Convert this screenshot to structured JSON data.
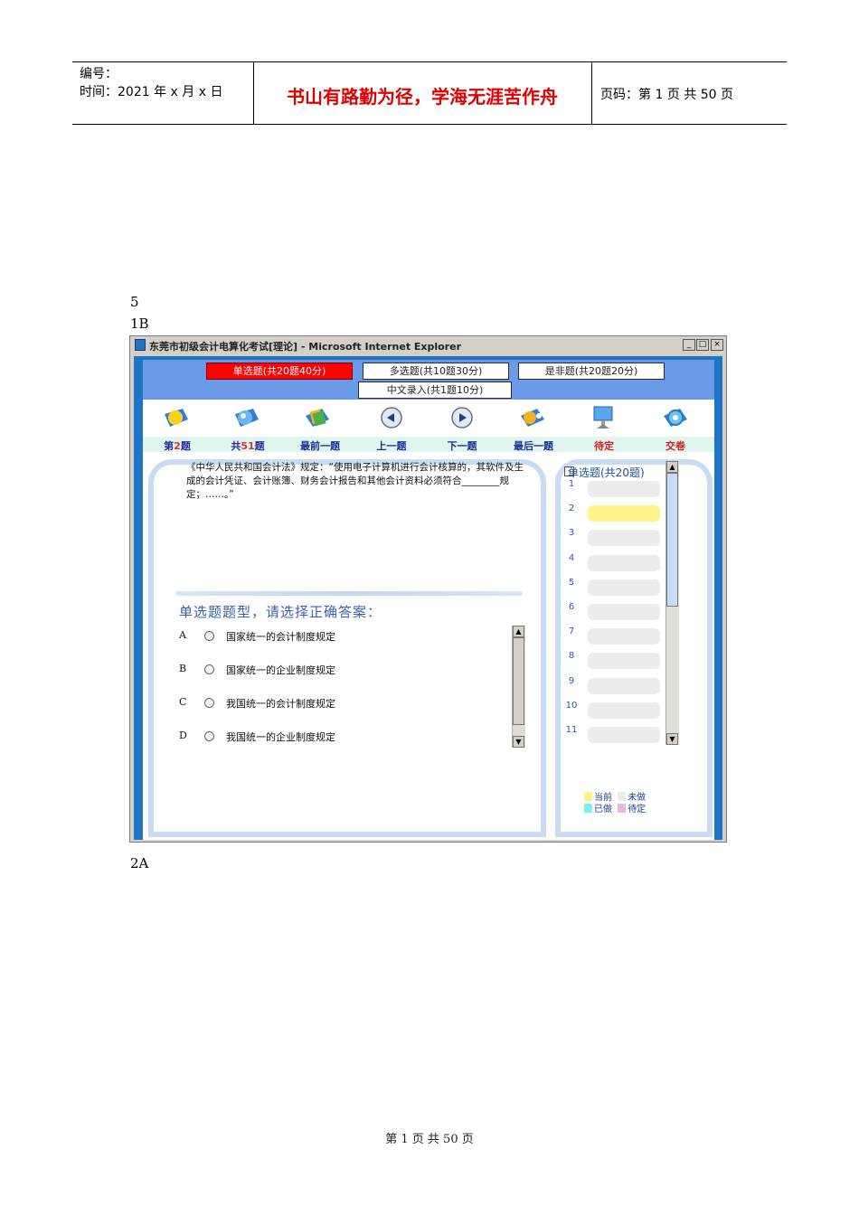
{
  "header": {
    "number_label": "编号：",
    "time_label": "时间：2021 年 x 月 x 日",
    "motto": "书山有路勤为径，学海无涯苦作舟",
    "page_label": "页码：第 1 页  共 50 页"
  },
  "body_text": {
    "line1": "5",
    "line2": "1B",
    "line3": "2A"
  },
  "ie": {
    "title": "东莞市初级会计电算化考试[理论] - Microsoft Internet Explorer",
    "window_buttons": [
      "_",
      "□",
      "×"
    ],
    "tabs": [
      {
        "label": "单选题(共20题40分)",
        "active": true
      },
      {
        "label": "多选题(共10题30分)",
        "active": false
      },
      {
        "label": "是非题(共20题20分)",
        "active": false
      },
      {
        "label": "中文录入(共1题10分)",
        "active": false
      }
    ],
    "toolbar": {
      "current_prefix": "第",
      "current_num": "2",
      "current_suffix": "题",
      "total_prefix": "共",
      "total_num": "51",
      "total_suffix": "题",
      "first": "最前一题",
      "prev": "上一题",
      "next": "下一题",
      "last": "最后一题",
      "pending": "待定",
      "submit": "交卷"
    },
    "question": {
      "text": "《中华人民共和国会计法》规定：“使用电子计算机进行会计核算的，其软件及生成的会计凭证、会计账簿、财务会计报告和其他会计资料必须符合________规定；……。”",
      "type_prompt": "单选题题型，请选择正确答案：",
      "options": [
        {
          "letter": "A",
          "text": "国家统一的会计制度规定"
        },
        {
          "letter": "B",
          "text": "国家统一的企业制度规定"
        },
        {
          "letter": "C",
          "text": "我国统一的会计制度规定"
        },
        {
          "letter": "D",
          "text": "我国统一的企业制度规定"
        }
      ]
    },
    "side": {
      "title": "单选题(共20题)",
      "toggle": "-",
      "items": [
        "1",
        "2",
        "3",
        "4",
        "5",
        "6",
        "7",
        "8",
        "9",
        "10",
        "11"
      ],
      "current_index": 1
    },
    "legend": {
      "current": "当前",
      "undone": "未做",
      "done": "已做",
      "pending": "待定",
      "colors": {
        "current": "#fff38a",
        "undone": "#ececec",
        "done": "#7ff0f0",
        "pending": "#e8b8e0"
      }
    }
  },
  "footer": "第  1  页  共  50  页"
}
